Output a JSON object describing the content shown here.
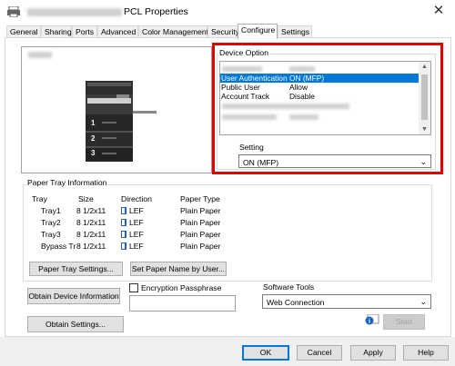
{
  "window": {
    "title": "PCL Properties",
    "close_glyph": "✕"
  },
  "tabs": [
    {
      "label": "General"
    },
    {
      "label": "Sharing"
    },
    {
      "label": "Ports"
    },
    {
      "label": "Advanced"
    },
    {
      "label": "Color Management"
    },
    {
      "label": "Security"
    },
    {
      "label": "Configure",
      "active": true
    },
    {
      "label": "Settings"
    }
  ],
  "device_option": {
    "label": "Device Option",
    "rows": [
      {
        "name": "User Authentication",
        "value": "ON (MFP)",
        "selected": true
      },
      {
        "name": "Public User",
        "value": "Allow"
      },
      {
        "name": "Account Track",
        "value": "Disable"
      }
    ],
    "setting_label": "Setting",
    "setting_value": "ON (MFP)"
  },
  "printer_image": {
    "tray_numbers": [
      "1",
      "2",
      "3"
    ]
  },
  "paper_tray": {
    "label": "Paper Tray Information",
    "headers": [
      "Tray",
      "Size",
      "Direction",
      "Paper Type"
    ],
    "rows": [
      {
        "tray": "Tray1",
        "size": "8 1/2x11",
        "direction": "LEF",
        "type": "Plain Paper"
      },
      {
        "tray": "Tray2",
        "size": "8 1/2x11",
        "direction": "LEF",
        "type": "Plain Paper"
      },
      {
        "tray": "Tray3",
        "size": "8 1/2x11",
        "direction": "LEF",
        "type": "Plain Paper"
      },
      {
        "tray": "Bypass Tr",
        "size": "8 1/2x11",
        "direction": "LEF",
        "type": "Plain Paper"
      }
    ],
    "settings_button": "Paper Tray Settings...",
    "set_name_button": "Set Paper Name by User..."
  },
  "buttons": {
    "obtain_device_info": "Obtain Device Information",
    "obtain_settings": "Obtain Settings...",
    "start": "Start"
  },
  "encryption": {
    "label": "Encryption Passphrase",
    "value": ""
  },
  "software_tools": {
    "label": "Software Tools",
    "value": "Web Connection"
  },
  "footer": {
    "ok": "OK",
    "cancel": "Cancel",
    "apply": "Apply",
    "help": "Help"
  },
  "colors": {
    "highlight": "#0078d7",
    "callout_red": "#e00000"
  },
  "icons": {
    "app": "printer-icon",
    "lef": "lef-page-icon",
    "info": "info-icon"
  }
}
